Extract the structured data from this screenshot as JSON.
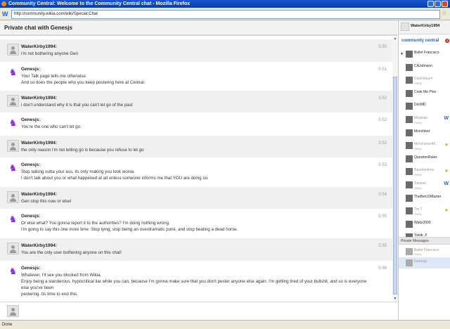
{
  "window": {
    "title": "Community Central: Welcome to the Community Central chat - Mozilla Firefox"
  },
  "browser": {
    "url": "http://community.wikia.com/wiki/Special:Chat",
    "status": "Done"
  },
  "chat": {
    "header": "Private chat with Genesjs",
    "input_placeholder": "",
    "messages": [
      {
        "author": "WaterKirby1994:",
        "lines": [
          "i'm not bothering anyone Gen"
        ],
        "time": "5:50",
        "avatar": "water"
      },
      {
        "author": "Genesjs:",
        "lines": [
          "Your Talk page tells me otherwise.",
          "And so does the people who you keep pestering here at Central."
        ],
        "time": "5:51",
        "avatar": "gen"
      },
      {
        "author": "WaterKirby1994:",
        "lines": [
          "i don't understand why it is that you can't let go of the past"
        ],
        "time": "5:52",
        "avatar": "water"
      },
      {
        "author": "Genesjs:",
        "lines": [
          "You're the one who can't let go."
        ],
        "time": "5:52",
        "avatar": "gen"
      },
      {
        "author": "WaterKirby1994:",
        "lines": [
          "the only reason i'm not letting go is because you refuse to let go"
        ],
        "time": "5:52",
        "avatar": "water"
      },
      {
        "author": "Genesjs:",
        "lines": [
          "Stop talking outta your ass, its only making you look worse.",
          "I don't talk about you or what happened at all unless someone informs me that YOU are doing so."
        ],
        "time": "5:53",
        "avatar": "gen"
      },
      {
        "author": "WaterKirby1994:",
        "lines": [
          "Gen stop this now or else!"
        ],
        "time": "5:54",
        "avatar": "water"
      },
      {
        "author": "Genesjs:",
        "lines": [
          "Or else what? You gonna report it to the authorities? I'm doing nothing wrong.",
          "I'm going to say this one more time: Stop lying, stop being an overdramatic punk, and stop beating a dead horse."
        ],
        "time": "5:55",
        "avatar": "gen"
      },
      {
        "author": "WaterKirby1994:",
        "lines": [
          "You are the only user bothering anyone on this chat!"
        ],
        "time": "5:55",
        "avatar": "water"
      },
      {
        "author": "Genesjs:",
        "lines": [
          "Whatever. I'll see you blocked from Wikia.",
          "Enjoy being a slanderous, hypocritical liar while you can, because I'm gonna make sure that you don't pester anyone else again. I'm getting tired of your bullshit, and so is everyone else you've been",
          "pestering. Its time to end this."
        ],
        "time": "5:56",
        "avatar": "gen"
      }
    ]
  },
  "sidebar": {
    "me": "WaterKirby1994",
    "wiki_logo": "community central",
    "notification_count": "2",
    "users": [
      {
        "name": "Bullet Francisco",
        "status": "",
        "badge": ""
      },
      {
        "name": "CAJohnson",
        "status": "",
        "badge": ""
      },
      {
        "name": "CatsNduty4",
        "status": "Away",
        "badge": ""
      },
      {
        "name": "Cook Me Plox",
        "status": "",
        "badge": ""
      },
      {
        "name": "DocMD",
        "status": "",
        "badge": ""
      },
      {
        "name": "Meginan",
        "status": "Away",
        "badge": "w"
      },
      {
        "name": "Monchbot",
        "status": "",
        "badge": ""
      },
      {
        "name": "Monchman45",
        "status": "Away",
        "badge": "s"
      },
      {
        "name": "QuestionRules",
        "status": "",
        "badge": ""
      },
      {
        "name": "Randomtime",
        "status": "Away",
        "badge": "s"
      },
      {
        "name": "Sannse",
        "status": "Away",
        "badge": "w"
      },
      {
        "name": "TheBen10Mazter",
        "status": "",
        "badge": ""
      },
      {
        "name": "Tm T",
        "status": "Away",
        "badge": "s"
      },
      {
        "name": "Wattz2000",
        "status": "",
        "badge": ""
      },
      {
        "name": "Yandr..F",
        "status": "",
        "badge": ""
      }
    ],
    "private_messages_label": "Private Messages",
    "private_users": [
      {
        "name": "Bullet Francisco",
        "status": "Away"
      },
      {
        "name": "Genesjs",
        "status": ""
      }
    ]
  }
}
